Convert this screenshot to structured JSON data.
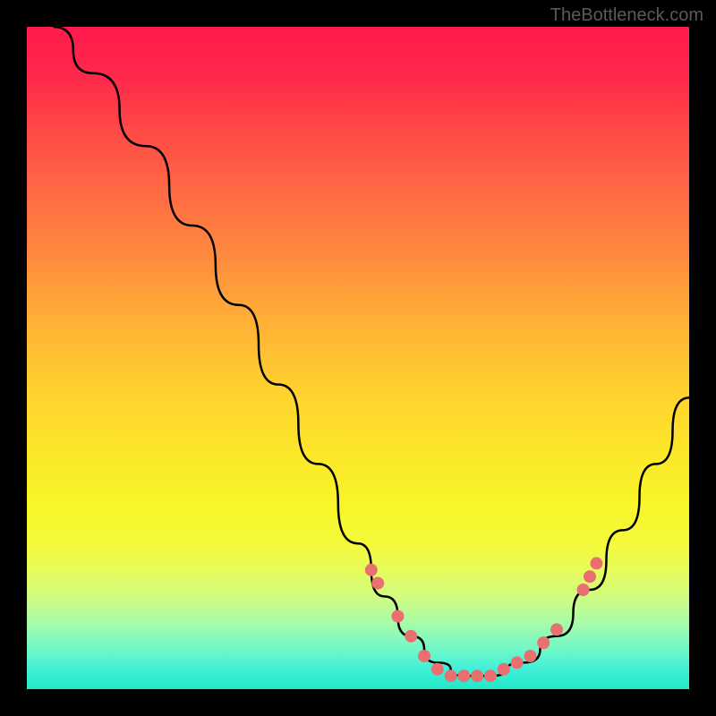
{
  "watermark": "TheBottleneck.com",
  "chart_data": {
    "type": "line",
    "title": "",
    "xlabel": "",
    "ylabel": "",
    "xlim": [
      0,
      100
    ],
    "ylim": [
      0,
      100
    ],
    "curve": {
      "name": "bottleneck-curve",
      "x": [
        4,
        10,
        18,
        25,
        32,
        38,
        44,
        50,
        54,
        58,
        62,
        66,
        70,
        75,
        80,
        85,
        90,
        95,
        100
      ],
      "y": [
        100,
        93,
        82,
        70,
        58,
        46,
        34,
        22,
        14,
        8,
        4,
        2,
        2,
        4,
        8,
        15,
        24,
        34,
        44
      ]
    },
    "scatter": {
      "name": "data-points",
      "color": "#e87070",
      "x": [
        52,
        53,
        56,
        58,
        60,
        62,
        64,
        66,
        68,
        70,
        72,
        74,
        76,
        78,
        80,
        84,
        85,
        86
      ],
      "y": [
        18,
        16,
        11,
        8,
        5,
        3,
        2,
        2,
        2,
        2,
        3,
        4,
        5,
        7,
        9,
        15,
        17,
        19
      ]
    },
    "background_gradient": {
      "top": "#ff1a4d",
      "middle": "#ffd22e",
      "bottom": "#20e8c8"
    }
  }
}
